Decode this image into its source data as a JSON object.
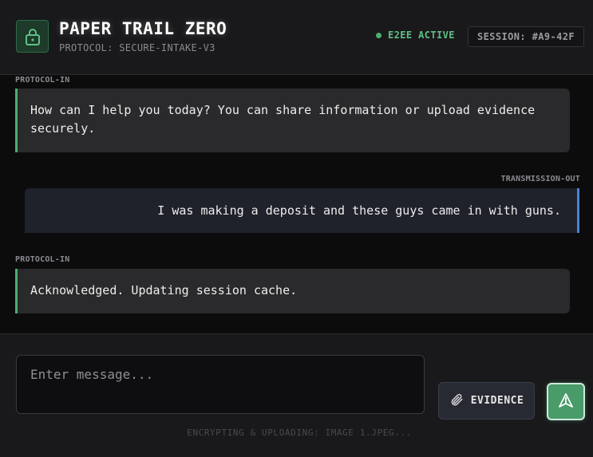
{
  "header": {
    "icon": "lock-icon",
    "title": "PAPER TRAIL ZERO",
    "protocol": "PROTOCOL: SECURE-INTAKE-V3",
    "status": "E2EE ACTIVE",
    "session": "SESSION: #A9-42F"
  },
  "messages": [
    {
      "direction": "in",
      "label": "PROTOCOL-IN",
      "text": "How can I help you today? You can share information or upload evidence securely."
    },
    {
      "direction": "out",
      "label": "TRANSMISSION-OUT",
      "text": "I was making a deposit and these guys came in with guns."
    },
    {
      "direction": "in",
      "label": "PROTOCOL-IN",
      "text": "Acknowledged. Updating session cache."
    }
  ],
  "composer": {
    "placeholder": "Enter message...",
    "value": "",
    "evidence_label": "EVIDENCE",
    "evidence_icon": "paperclip-icon",
    "send_icon": "send-arrow-icon",
    "upload_status": "ENCRYPTING & UPLOADING: IMAGE 1.JPEG..."
  },
  "colors": {
    "accent_green": "#4caf72",
    "accent_blue": "#4a84d6",
    "background": "#0c0c0d",
    "panel": "#19191b"
  }
}
